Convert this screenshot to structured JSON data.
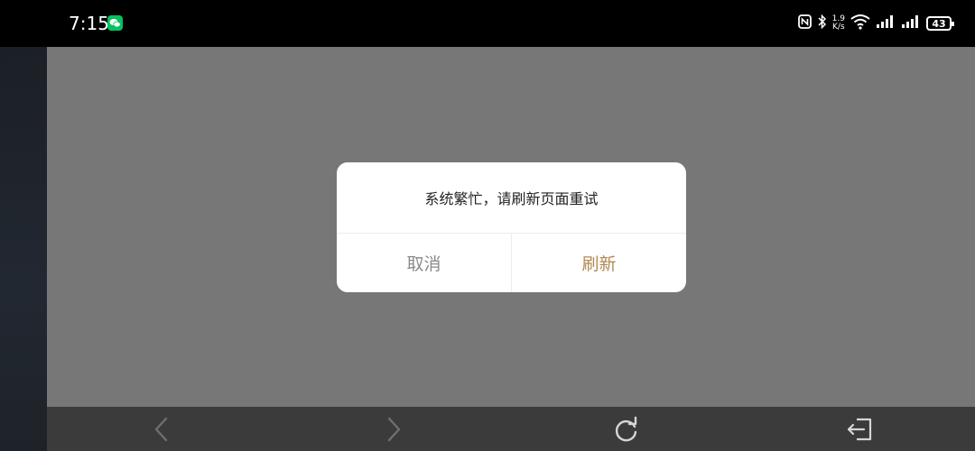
{
  "status_bar": {
    "time": "7:15",
    "network_speed_value": "1.9",
    "network_speed_unit": "K/s",
    "battery": "43",
    "icons": [
      "wechat-icon",
      "nfc-icon",
      "bluetooth-icon",
      "wifi-icon",
      "signal-icon",
      "signal-icon",
      "battery-icon"
    ]
  },
  "dialog": {
    "message": "系统繁忙，请刷新页面重试",
    "cancel_label": "取消",
    "refresh_label": "刷新"
  },
  "toolbar": {
    "icons": [
      "back-arrow-icon",
      "forward-arrow-icon",
      "reload-icon",
      "exit-icon"
    ]
  },
  "colors": {
    "overlay": "#777777",
    "dialog_bg": "#ffffff",
    "cancel_text": "#8a8a8e",
    "refresh_text": "#b08a4f",
    "toolbar_bg": "#3b3b3b"
  }
}
